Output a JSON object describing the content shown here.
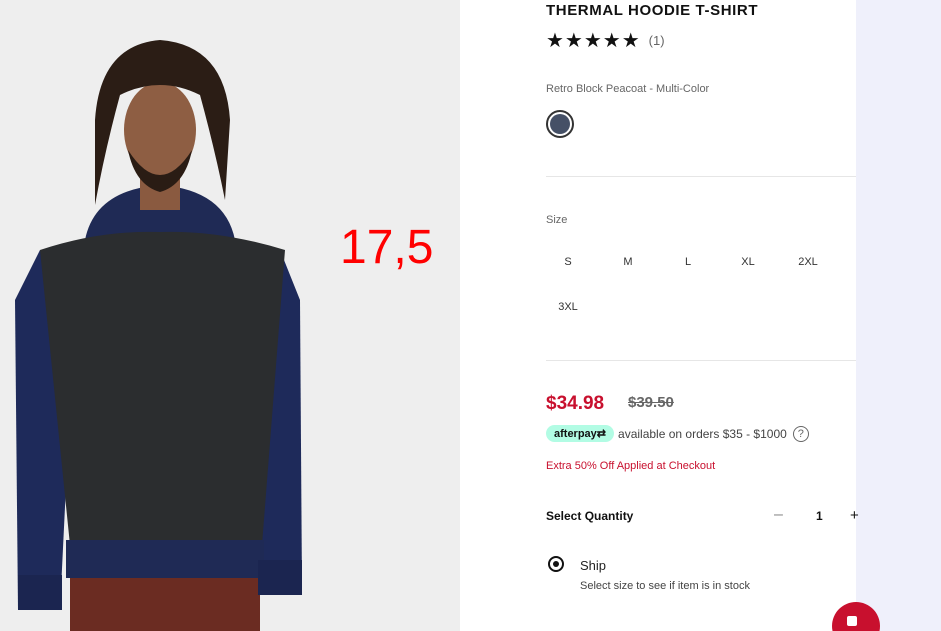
{
  "annotation": "17,5",
  "product": {
    "title": "THERMAL HOODIE T-SHIRT",
    "stars": "★★★★★",
    "review_count": "(1)",
    "color_name": "Retro Block Peacoat - Multi-Color",
    "swatch_color": "#455066"
  },
  "size": {
    "label": "Size",
    "options": [
      "S",
      "M",
      "L",
      "XL",
      "2XL",
      "3XL"
    ]
  },
  "price": {
    "sale": "$34.98",
    "original": "$39.50"
  },
  "afterpay": {
    "badge": "afterpay⇄",
    "text": "available on orders $35 - $1000",
    "help": "?"
  },
  "promo": "Extra 50% Off Applied at Checkout",
  "quantity": {
    "label": "Select Quantity",
    "minus": "–",
    "value": "1",
    "plus": "+"
  },
  "shipping": {
    "option": "Ship",
    "note": "Select size to see if item is in stock"
  },
  "colors": {
    "sale_red": "#c8102e",
    "afterpay_mint": "#b2fce4",
    "hoodie_body": "#2b2d2f",
    "hoodie_sleeve": "#1f2a55"
  }
}
